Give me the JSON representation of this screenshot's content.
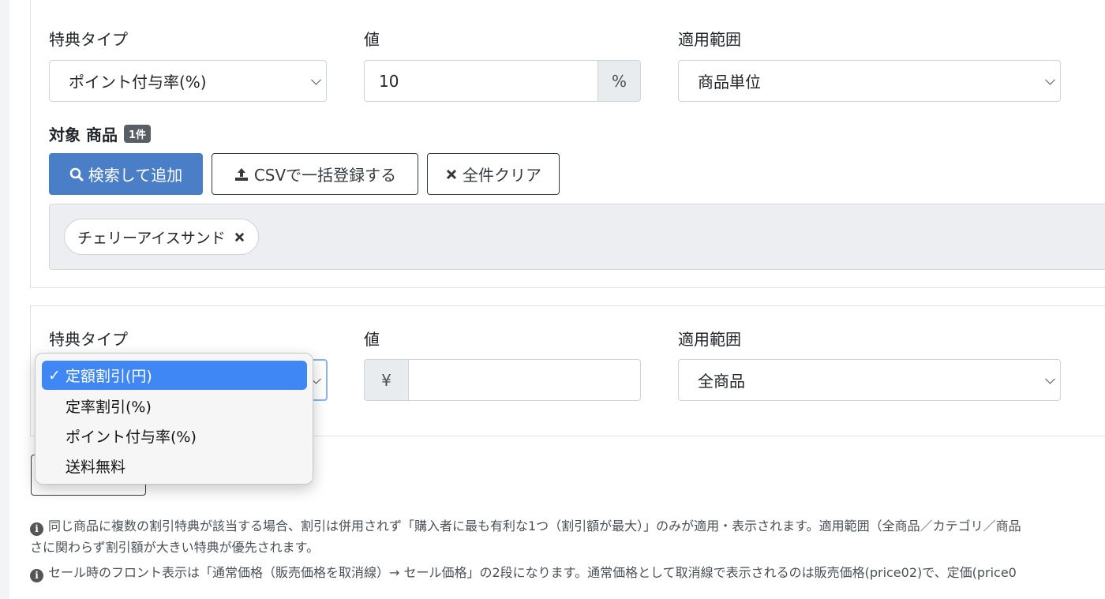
{
  "block1": {
    "benefit_type_label": "特典タイプ",
    "benefit_type_value": "ポイント付与率(%)",
    "value_label": "値",
    "value": "10",
    "value_unit": "%",
    "scope_label": "適用範囲",
    "scope_value": "商品単位",
    "target_label": "対象 商品",
    "target_count": "1件",
    "search_add_button": "検索して追加",
    "csv_button": "CSVで一括登録する",
    "clear_button": "全件クリア",
    "products": [
      "チェリーアイスサンド"
    ]
  },
  "block2": {
    "benefit_type_label": "特典タイプ",
    "value_label": "値",
    "value_prefix": "¥",
    "value": "",
    "scope_label": "適用範囲",
    "scope_value": "全商品"
  },
  "dropdown": {
    "options": [
      "定額割引(円)",
      "定率割引(%)",
      "ポイント付与率(%)",
      "送料無料"
    ],
    "selected": "定額割引(円)"
  },
  "notes": [
    "同じ商品に複数の割引特典が該当する場合、割引は併用されず「購入者に最も有利な1つ（割引額が最大）」のみが適用・表示されます。適用範囲（全商品／カテゴリ／商品",
    "さに関わらず割引額が大きい特典が優先されます。",
    "セール時のフロント表示は「通常価格（販売価格を取消線）→ セール価格」の2段になります。通常価格として取消線で表示されるのは販売価格(price02)で、定価(price0"
  ],
  "colors": {
    "primary": "#4a7fc8",
    "selected_option": "#3f87f5"
  },
  "icons": [
    "search-icon",
    "upload-icon",
    "close-icon",
    "info-icon",
    "check-icon"
  ]
}
